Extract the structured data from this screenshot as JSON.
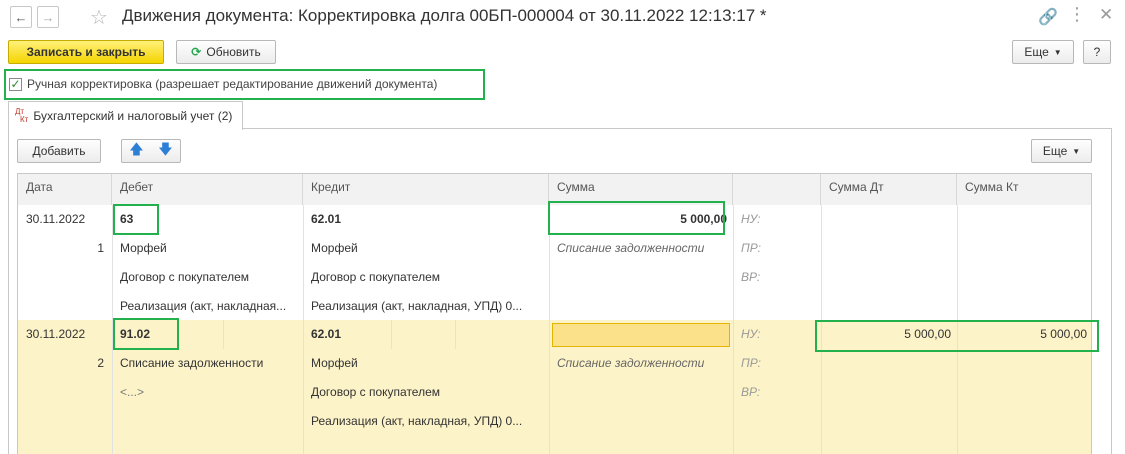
{
  "window": {
    "title": "Движения документа: Корректировка долга 00БП-000004 от 30.11.2022 12:13:17 *"
  },
  "toolbar": {
    "save_close": "Записать и закрыть",
    "refresh": "Обновить",
    "more": "Еще",
    "help": "?"
  },
  "manual_checkbox": {
    "label": "Ручная корректировка (разрешает редактирование движений документа)",
    "checked": true
  },
  "tab": {
    "icon_top": "Дт",
    "icon_bottom": "Кт",
    "label": "Бухгалтерский и налоговый учет (2)"
  },
  "table_toolbar": {
    "add": "Добавить",
    "more": "Еще"
  },
  "table": {
    "headers": [
      "Дата",
      "Дебет",
      "Кредит",
      "Сумма",
      "Сумма Дт",
      "Сумма Кт"
    ],
    "rows": [
      {
        "date": "30.11.2022",
        "num": "1",
        "debit": [
          "63",
          "Морфей",
          "Договор с покупателем",
          "Реализация (акт, накладная..."
        ],
        "credit": [
          "62.01",
          "Морфей",
          "Договор с покупателем",
          "Реализация (акт, накладная, УПД) 0..."
        ],
        "amount": "5 000,00",
        "content": "Списание задолженности",
        "labels": [
          "НУ:",
          "ПР:",
          "ВР:"
        ],
        "sum_dt": "",
        "sum_kt": ""
      },
      {
        "date": "30.11.2022",
        "num": "2",
        "debit": [
          "91.02",
          "Списание задолженности",
          "<...>",
          ""
        ],
        "credit": [
          "62.01",
          "Морфей",
          "Договор с покупателем",
          "Реализация (акт, накладная, УПД) 0..."
        ],
        "amount": "",
        "content": "Списание задолженности",
        "labels": [
          "НУ:",
          "ПР:",
          "ВР:"
        ],
        "sum_dt": "5 000,00",
        "sum_kt": "5 000,00"
      }
    ]
  },
  "colors": {
    "highlight": "#22b14c",
    "selected_row": "#fdf3c8",
    "edit_cell": "#fbe28a"
  }
}
